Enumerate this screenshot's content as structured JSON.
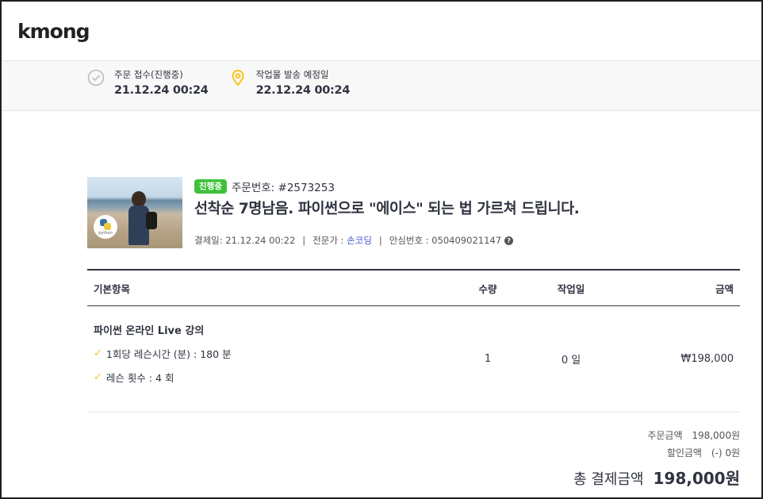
{
  "header": {
    "logo": "kmong"
  },
  "status": {
    "received": {
      "label": "주문 접수(진행중)",
      "date": "21.12.24 00:24"
    },
    "delivery": {
      "label": "작업물 발송 예정일",
      "date": "22.12.24 00:24"
    }
  },
  "order": {
    "badge": "진행중",
    "number": "주문번호: #2573253",
    "title": "선착순 7명남음. 파이썬으로 \"에이스\" 되는 법 가르쳐 드립니다.",
    "paid_at": "결제일: 21.12.24 00:22",
    "expert_label": "전문가 :",
    "expert_name": "손코딩",
    "safe_number": "안심번호 : 050409021147",
    "thumb_badge_text": "python"
  },
  "table": {
    "headers": {
      "item": "기본항목",
      "qty": "수량",
      "days": "작업일",
      "amount": "금액"
    },
    "rows": [
      {
        "name": "파이썬 온라인 Live 강의",
        "options": [
          "1회당 레슨시간 (분) : 180 분",
          "레슨 횟수 : 4 회"
        ],
        "qty": "1",
        "days": "0 일",
        "amount": "₩198,000"
      }
    ]
  },
  "totals": {
    "order_label": "주문금액",
    "order_value": "198,000원",
    "discount_label": "할인금액",
    "discount_value": "(-) 0원",
    "total_label": "총 결제금액",
    "total_value": "198,000원"
  },
  "colors": {
    "badge": "#3ec13a",
    "expert_link": "#3f57d1",
    "check": "#f5c518",
    "pin": "#f5c518"
  },
  "icons": {
    "received": "check-circle-icon",
    "delivery": "location-pin-icon",
    "help": "help-icon",
    "check": "check-icon"
  }
}
